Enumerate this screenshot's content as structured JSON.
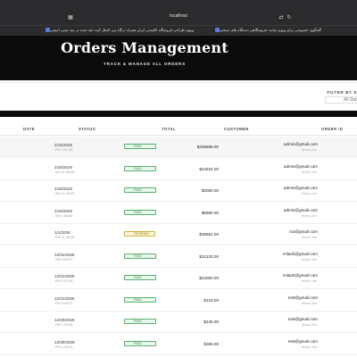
{
  "browser": {
    "address": "localhost",
    "bookmarks": [
      "گفتگوی خصوصی برای ویوی سایت فروشگاهی دستگاه های صنعتی",
      "ویوی طراحی فروشگاه اکلیسی ایران همراه درگاه بین الملل کیت نقد شده در سه چینی امنیتی"
    ]
  },
  "hero": {
    "title": "Orders Management",
    "subtitle": "TRACK & MANAGE ALL ORDERS"
  },
  "filter": {
    "label": "FILTER BY S",
    "selected": "All Stat"
  },
  "table": {
    "headers": {
      "date": "DATE",
      "status": "STATUS",
      "total": "TOTAL",
      "customer": "CUSTOMER",
      "order_id": "ORDER ID"
    },
    "rows": [
      {
        "date": "2/16/2026",
        "time": "PM 2:37:06",
        "status": "PAID",
        "total": "$258888.00",
        "email": "admin@gmail.com",
        "location": "tehran, iran"
      },
      {
        "date": "2/16/2026",
        "time": "AM 11:55:48",
        "status": "PAID",
        "total": "$24624.00",
        "email": "admin@gmail.com",
        "location": "tehran, iran"
      },
      {
        "date": "2/16/2026",
        "time": "AM 11:49:53",
        "status": "PAID",
        "total": "$3000.00",
        "email": "admin@gmail.com",
        "location": "tehran, iran"
      },
      {
        "date": "2/16/2026",
        "time": "AM 1:36:56",
        "status": "PAID",
        "total": "$6690.00",
        "email": "admin@gmail.com",
        "location": "tehran, iran"
      },
      {
        "date": "1/1/2026",
        "time": "PM 11:38:15",
        "status": "PENDING",
        "total": "$38661.00",
        "email": "rza@gmail.com",
        "location": "tehran, iran"
      },
      {
        "date": "12/31/2025",
        "time": "PM 3:09:47",
        "status": "PAID",
        "total": "$12133.00",
        "email": "milad2@gmail.com",
        "location": "tehran, iran"
      },
      {
        "date": "12/31/2025",
        "time": "PM 2:37:00",
        "status": "PAID",
        "total": "$24000.00",
        "email": "milad2@gmail.com",
        "location": "tehran, iran"
      },
      {
        "date": "12/31/2025",
        "time": "PM 4:44:37",
        "status": "PAID",
        "total": "$123.00",
        "email": "test@gmail.com",
        "location": "tehran, iran"
      },
      {
        "date": "12/30/2025",
        "time": "PM 1:33:06",
        "status": "PAID",
        "total": "$246.00",
        "email": "test@gmail.com",
        "location": "tehran, iran"
      },
      {
        "date": "12/30/2025",
        "time": "PM 1:15:29",
        "status": "PAID",
        "total": "$369.00",
        "email": "test@gmail.com",
        "location": "tehran, iran"
      }
    ]
  }
}
